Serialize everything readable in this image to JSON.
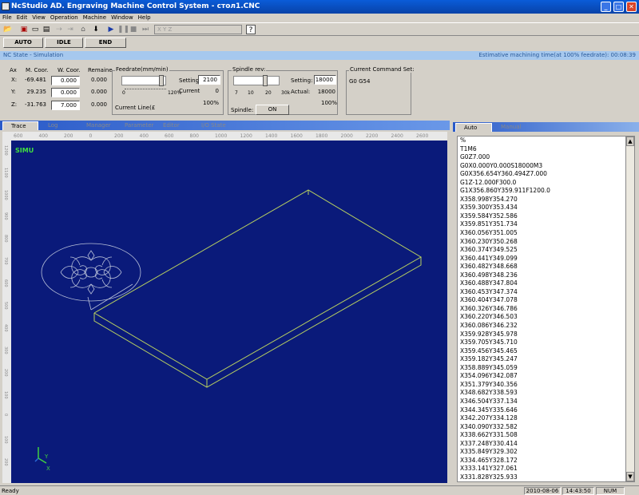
{
  "window": {
    "title": "NcStudio AD. Engraving Machine Control System  - стол1.CNC"
  },
  "menu": [
    "File",
    "Edit",
    "View",
    "Operation",
    "Machine",
    "Window",
    "Help"
  ],
  "toolbar": {
    "coord_display": "X      Y      Z"
  },
  "state_buttons": [
    "AUTO",
    "IDLE",
    "END"
  ],
  "nc_state": {
    "label": "NC State - Simulation",
    "estimate": "Estimative machining time(at 100% feedrate): 00:08:39"
  },
  "axes": {
    "header": {
      "axis": "Ax",
      "machine": "M. Coor.",
      "work": "W. Coor.",
      "remain": "Remaine"
    },
    "rows": [
      {
        "axis": "X:",
        "machine": "-69.481",
        "work": "0.000",
        "remain": "0.000"
      },
      {
        "axis": "Y:",
        "machine": "29.235",
        "work": "0.000",
        "remain": "0.000"
      },
      {
        "axis": "Z:",
        "machine": "-31.763",
        "work": "7.000",
        "remain": "0.000"
      }
    ]
  },
  "feedrate": {
    "title": "Feedrate(mm/min)",
    "setting_label": "Setting:",
    "setting_value": "2100",
    "current_label": "Current",
    "current_value": "0",
    "scale_min": "0",
    "scale_max": "120%",
    "percent": "100%",
    "current_line_label": "Current Line(£"
  },
  "spindle": {
    "title": "Spindle rev:",
    "setting_label": "Setting:",
    "setting_value": "18000",
    "actual_label": "Actual:",
    "actual_value": "18000",
    "scale": [
      "7",
      "10",
      "20",
      "30k"
    ],
    "percent": "100%",
    "spindle_label": "Spindle:",
    "spindle_button": "ON"
  },
  "command_set": {
    "title": "Current Command Set:",
    "value": "G0 G54"
  },
  "view_tabs": [
    "Trace",
    "Log",
    "Manager",
    "Parameter",
    "Editor",
    "I/O State"
  ],
  "ruler": [
    "600",
    "400",
    "200",
    "0",
    "200",
    "400",
    "600",
    "800",
    "1000",
    "1200",
    "1400",
    "1600",
    "1800",
    "2000",
    "2200",
    "2400",
    "2600"
  ],
  "ruler_v": [
    "1200",
    "1100",
    "1000",
    "900",
    "800",
    "700",
    "600",
    "500",
    "400",
    "300",
    "200",
    "100",
    "0",
    "100",
    "200"
  ],
  "canvas": {
    "mode_label": "SIMU",
    "axis_y": "Y",
    "axis_x": "X"
  },
  "code_tabs": [
    "Auto",
    "Manual"
  ],
  "code_lines": [
    "%",
    "T1M6",
    "G0Z7.000",
    "G0X0.000Y0.000S18000M3",
    "G0X356.654Y360.494Z7.000",
    "G1Z-12.000F300.0",
    "G1X356.860Y359.911F1200.0",
    "X358.998Y354.270",
    "X359.300Y353.434",
    "X359.584Y352.586",
    "X359.851Y351.734",
    "X360.056Y351.005",
    "X360.230Y350.268",
    "X360.374Y349.525",
    "X360.441Y349.099",
    "X360.482Y348.668",
    "X360.498Y348.236",
    "X360.488Y347.804",
    "X360.453Y347.374",
    "X360.404Y347.078",
    "X360.326Y346.786",
    "X360.220Y346.503",
    "X360.086Y346.232",
    "X359.928Y345.978",
    "X359.705Y345.710",
    "X359.456Y345.465",
    "X359.182Y345.247",
    "X358.889Y345.059",
    "X354.096Y342.087",
    "X351.379Y340.356",
    "X348.682Y338.593",
    "X346.504Y337.134",
    "X344.345Y335.646",
    "X342.207Y334.128",
    "X340.090Y332.582",
    "X338.662Y331.508",
    "X337.248Y330.414",
    "X335.849Y329.302",
    "X334.465Y328.172",
    "X333.141Y327.061",
    "X331.828Y325.933"
  ],
  "status": {
    "left": "Ready",
    "date": "2010-08-06",
    "time": "14:43:50",
    "num": "NUM"
  }
}
